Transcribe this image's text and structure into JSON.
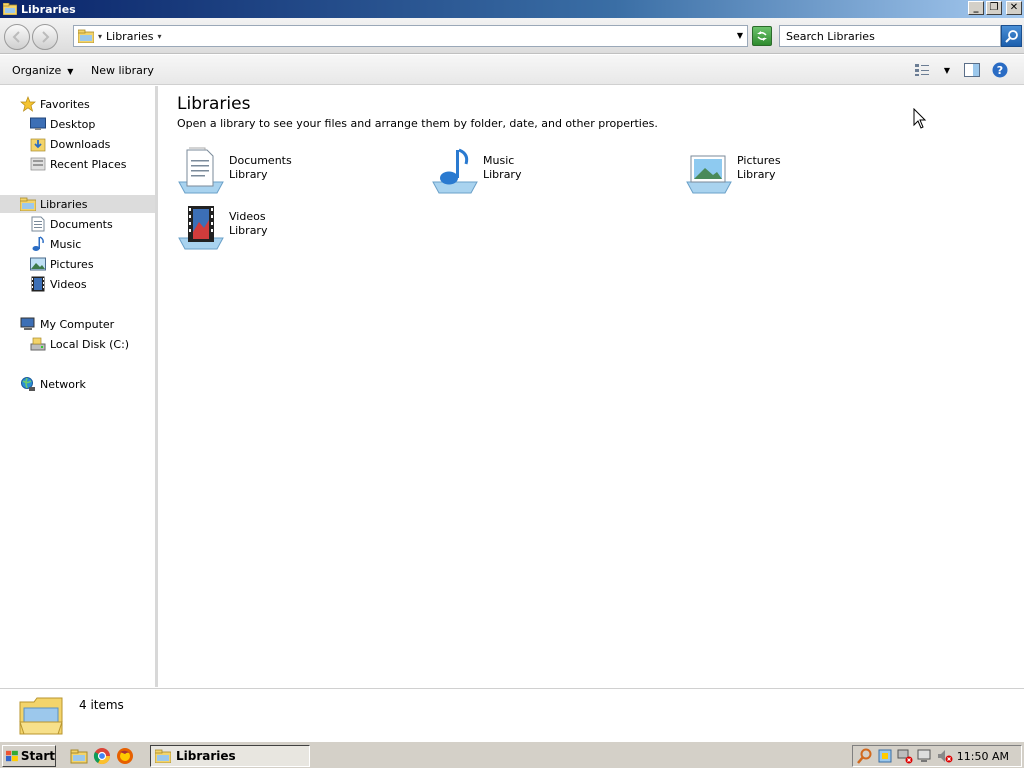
{
  "window": {
    "title": "Libraries",
    "minimize_glyph": "_",
    "restore_glyph": "❐",
    "close_glyph": "✕"
  },
  "address": {
    "crumb": "Libraries",
    "search_placeholder": "Search Libraries"
  },
  "commands": {
    "organize": "Organize",
    "new_library": "New library"
  },
  "nav": {
    "favorites": "Favorites",
    "desktop": "Desktop",
    "downloads": "Downloads",
    "recent_places": "Recent Places",
    "libraries": "Libraries",
    "documents": "Documents",
    "music": "Music",
    "pictures": "Pictures",
    "videos": "Videos",
    "my_computer": "My Computer",
    "local_disk": "Local Disk (C:)",
    "network": "Network"
  },
  "main": {
    "title": "Libraries",
    "subtitle": "Open a library to see your files and arrange them by folder, date, and other properties.",
    "libraries": [
      {
        "name": "Documents",
        "type": "Library",
        "icon": "documents-library-icon"
      },
      {
        "name": "Music",
        "type": "Library",
        "icon": "music-library-icon"
      },
      {
        "name": "Pictures",
        "type": "Library",
        "icon": "pictures-library-icon"
      },
      {
        "name": "Videos",
        "type": "Library",
        "icon": "videos-library-icon"
      }
    ]
  },
  "details": {
    "count": "4 items"
  },
  "taskbar": {
    "start": "Start",
    "task": "Libraries",
    "clock": "11:50 AM"
  },
  "colors": {
    "title_gradient_start": "#0a246a",
    "title_gradient_end": "#a6caf0",
    "selected_nav": "#dcdcdc",
    "taskbar": "#d4d0c8"
  }
}
